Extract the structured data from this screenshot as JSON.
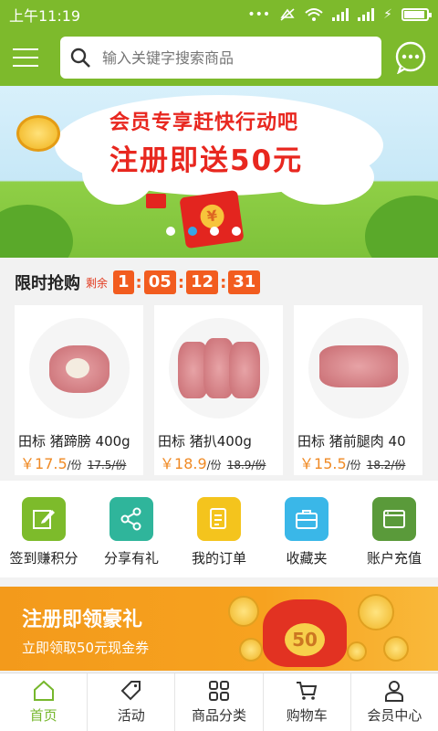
{
  "status_bar": {
    "time": "上午11:19",
    "battery_level": 0.9
  },
  "header": {
    "search_placeholder": "输入关键字搜索商品"
  },
  "banner": {
    "title": "会员专享赶快行动吧",
    "subtitle": "注册即送50元",
    "envelope_symbol": "¥",
    "active_slide": 2,
    "slide_count": 4
  },
  "flash_sale": {
    "title": "限时抢购",
    "remaining_label": "剩余",
    "countdown": {
      "d": "1",
      "h": "05",
      "m": "12",
      "s": "31"
    },
    "currency": "￥",
    "per_unit": "/份",
    "products": [
      {
        "name": "田标 猪蹄膀 400g",
        "price": "17.5",
        "old_price": "17.5/份"
      },
      {
        "name": "田标 猪扒400g",
        "price": "18.9",
        "old_price": "18.9/份"
      },
      {
        "name": "田标 猪前腿肉 40",
        "price": "15.5",
        "old_price": "18.2/份"
      }
    ]
  },
  "actions": [
    {
      "label": "签到赚积分",
      "color": "#7dbb2b"
    },
    {
      "label": "分享有礼",
      "color": "#2fb59b"
    },
    {
      "label": "我的订单",
      "color": "#f4c41d"
    },
    {
      "label": "收藏夹",
      "color": "#3ab7e8"
    },
    {
      "label": "账户充值",
      "color": "#5a9a3a"
    }
  ],
  "promo": {
    "title": "注册即领豪礼",
    "subtitle": "立即领取50元现金券",
    "bag_value": "50"
  },
  "tabbar": [
    {
      "label": "首页"
    },
    {
      "label": "活动"
    },
    {
      "label": "商品分类"
    },
    {
      "label": "购物车"
    },
    {
      "label": "会员中心"
    }
  ],
  "colors": {
    "brand": "#7dba2c",
    "accent": "#f25c1f",
    "price": "#f08a24"
  }
}
